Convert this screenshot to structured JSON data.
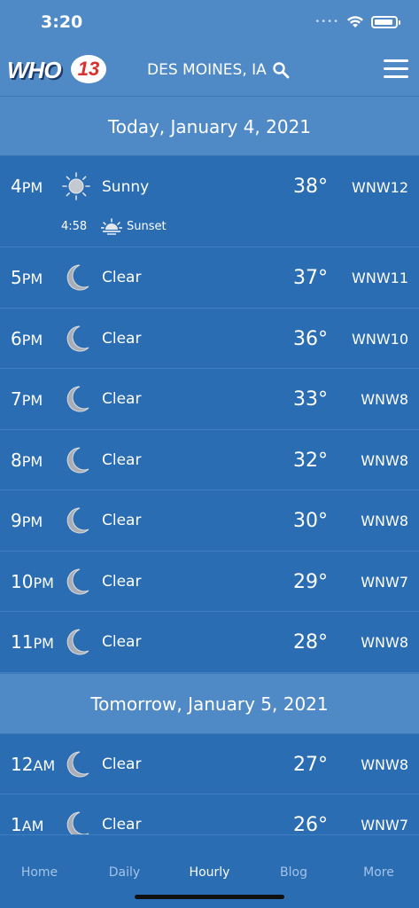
{
  "status_bar": {
    "time": "3:20",
    "signal": "••••",
    "battery_level": 0.9
  },
  "header": {
    "logo_text": "WHO",
    "logo_number": "13",
    "location": "DES MOINES, IA"
  },
  "sections": [
    {
      "title": "Today, January 4, 2021"
    },
    {
      "title": "Tomorrow, January 5, 2021"
    }
  ],
  "rows": [
    {
      "hour": "4",
      "ampm": "PM",
      "icon": "sun-icon",
      "condition": "Sunny",
      "temp": "38°",
      "wind": "WNW12",
      "event": {
        "time": "4:58",
        "icon": "sunset-icon",
        "label": "Sunset"
      }
    },
    {
      "hour": "5",
      "ampm": "PM",
      "icon": "moon-icon",
      "condition": "Clear",
      "temp": "37°",
      "wind": "WNW11"
    },
    {
      "hour": "6",
      "ampm": "PM",
      "icon": "moon-icon",
      "condition": "Clear",
      "temp": "36°",
      "wind": "WNW10"
    },
    {
      "hour": "7",
      "ampm": "PM",
      "icon": "moon-icon",
      "condition": "Clear",
      "temp": "33°",
      "wind": "WNW8"
    },
    {
      "hour": "8",
      "ampm": "PM",
      "icon": "moon-icon",
      "condition": "Clear",
      "temp": "32°",
      "wind": "WNW8"
    },
    {
      "hour": "9",
      "ampm": "PM",
      "icon": "moon-icon",
      "condition": "Clear",
      "temp": "30°",
      "wind": "WNW8"
    },
    {
      "hour": "10",
      "ampm": "PM",
      "icon": "moon-icon",
      "condition": "Clear",
      "temp": "29°",
      "wind": "WNW7"
    },
    {
      "hour": "11",
      "ampm": "PM",
      "icon": "moon-icon",
      "condition": "Clear",
      "temp": "28°",
      "wind": "WNW8"
    },
    {
      "hour": "12",
      "ampm": "AM",
      "icon": "moon-icon",
      "condition": "Clear",
      "temp": "27°",
      "wind": "WNW8"
    },
    {
      "hour": "1",
      "ampm": "AM",
      "icon": "moon-icon",
      "condition": "Clear",
      "temp": "26°",
      "wind": "WNW7"
    }
  ],
  "tabs": [
    {
      "label": "Home",
      "active": false
    },
    {
      "label": "Daily",
      "active": false
    },
    {
      "label": "Hourly",
      "active": true
    },
    {
      "label": "Blog",
      "active": false
    },
    {
      "label": "More",
      "active": false
    }
  ],
  "colors": {
    "background": "#2a6db3",
    "header": "#4f8ac6",
    "inactive_tab": "#a5c3e6"
  }
}
